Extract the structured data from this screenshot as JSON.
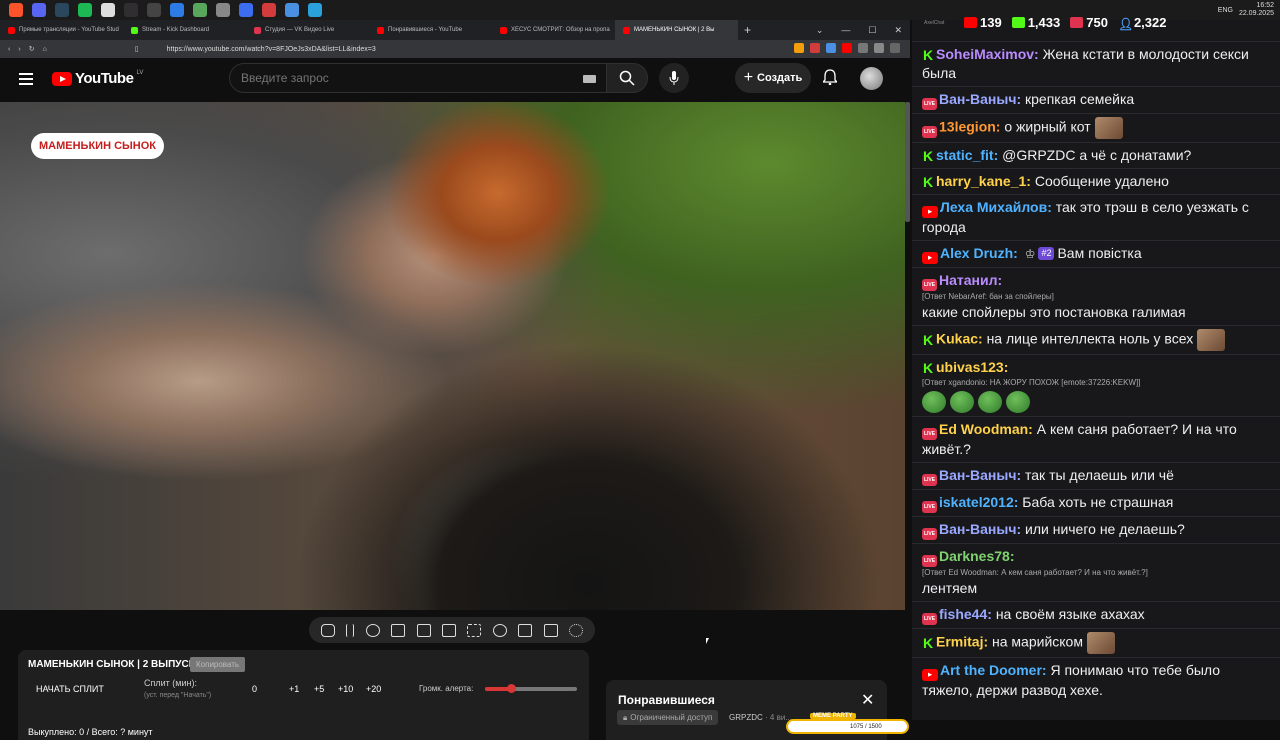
{
  "taskbar": {
    "icons": [
      {
        "name": "brave-icon",
        "color": "#fb542b"
      },
      {
        "name": "discord-icon",
        "color": "#5865f2"
      },
      {
        "name": "steam-icon",
        "color": "#2a475e"
      },
      {
        "name": "spotify-icon",
        "color": "#1db954"
      },
      {
        "name": "chrome-icon",
        "color": "#dddddd"
      },
      {
        "name": "obs-icon",
        "color": "#302e31"
      },
      {
        "name": "app-x-icon",
        "color": "#444444"
      },
      {
        "name": "app-blue-icon",
        "color": "#2d7be5"
      },
      {
        "name": "app-green-icon",
        "color": "#58a55c"
      },
      {
        "name": "app-arrow-icon",
        "color": "#888888"
      },
      {
        "name": "app-round-icon",
        "color": "#3c6cf0"
      },
      {
        "name": "app-red-icon",
        "color": "#d23c3c"
      },
      {
        "name": "app-blue2-icon",
        "color": "#4a90e2"
      },
      {
        "name": "telegram-icon",
        "color": "#2aa1da"
      }
    ],
    "lang": "ENG",
    "time": "16:52",
    "date": "22.09.2025"
  },
  "tabs": [
    {
      "label": "Прямые трансляции - YouTube Stud",
      "color": "#ff0000"
    },
    {
      "label": "Stream - Kick Dashboard",
      "color": "#53fc18"
    },
    {
      "label": "Студия — VK Видео Live",
      "color": "#e0334f"
    },
    {
      "label": "Понравившиеся - YouTube",
      "color": "#ff0000"
    },
    {
      "label": "ХЕСУС СМОТРИТ: Обзор на пропа",
      "color": "#ff0000"
    },
    {
      "label": "МАМЕНЬКИН СЫНОК | 2 Вы",
      "color": "#ff0000"
    }
  ],
  "address": {
    "url": "https://www.youtube.com/watch?v=8FJOeJs3xDA&list=LL&index=3"
  },
  "youtube": {
    "logo_text": "YouTube",
    "country": "LV",
    "search_placeholder": "Введите запрос",
    "create_label": "Создать"
  },
  "video": {
    "badge": "МАМЕНЬКИН СЫНОК"
  },
  "split": {
    "title": "МАМЕНЬКИН СЫНОК | 2 ВЫПУСК",
    "copy": "Копировать",
    "start": "НАЧАТЬ СПЛИТ",
    "min_label": "Сплит (мин):",
    "hint": "(уст. перед \"Начать\")",
    "zero": "0",
    "increments": [
      "+1",
      "+5",
      "+10",
      "+20"
    ],
    "alert_label": "Громк. алерта:",
    "alert_volume": 0.28,
    "bought": "Выкуплено: 0 / Всего: ? минут"
  },
  "liked": {
    "title": "Понравившиеся",
    "restricted": "Ограниченный доступ",
    "owner": "GRPZDC",
    "meta": "· 4 ви..."
  },
  "meme_party": {
    "badge": "MEME PARTY",
    "progress": "1075 / 1500"
  },
  "chat": {
    "app_name": "AxelChat",
    "stats": [
      {
        "platform": "youtube",
        "value": "139",
        "color": "#ff0000"
      },
      {
        "platform": "kick",
        "value": "1,433",
        "color": "#53fc18"
      },
      {
        "platform": "vk",
        "value": "750",
        "color": "#e0334f"
      },
      {
        "platform": "total",
        "value": "2,322",
        "color": "#4aa3ff"
      }
    ],
    "messages": [
      {
        "platform": "kick",
        "user": "SoheiMaximov:",
        "color": "#b98cff",
        "text": "Жена кстати в молодости секси была"
      },
      {
        "platform": "vk",
        "user": "Ван-Ваныч:",
        "color": "#9aa8ff",
        "text": "крепкая семейка"
      },
      {
        "platform": "vk",
        "user": "13legion:",
        "color": "#ff9933",
        "text": "о жирный кот",
        "emote": true
      },
      {
        "platform": "kick",
        "user": "static_fit:",
        "color": "#4fb3ff",
        "text": "@GRPZDC а чё с донатами?"
      },
      {
        "platform": "kick",
        "user": "harry_kane_1:",
        "color": "#ffd24a",
        "text": "Сообщение удалено"
      },
      {
        "platform": "yt",
        "user": "Леха Михайлов:",
        "color": "#4fb3ff",
        "text": "так это трэш в село уезжать с города"
      },
      {
        "platform": "yt",
        "user": "Alex Druzh:",
        "color": "#4fb3ff",
        "crown": true,
        "sub": "#2",
        "text": "Вам повістка"
      },
      {
        "platform": "vk",
        "user": "Натанил:",
        "color": "#b98cff",
        "reply": "[Ответ NebarAref: бан за спойлеры]",
        "text": "какие спойлеры это постановка галимая"
      },
      {
        "platform": "kick",
        "user": "Kukac:",
        "color": "#ffd24a",
        "text": "на лице интеллекта ноль у всех",
        "emote": true
      },
      {
        "platform": "kick",
        "user": "ubivas123:",
        "color": "#ffd24a",
        "reply": "[Ответ xgandonio: НА ЖОРУ ПОХОЖ [emote:37226:KEKW]]",
        "frogs": 4,
        "text": ""
      },
      {
        "platform": "vk",
        "user": "Ed Woodman:",
        "color": "#ffd24a",
        "text": "А кем саня работает? И на что живёт.?"
      },
      {
        "platform": "vk",
        "user": "Ван-Ваныч:",
        "color": "#9aa8ff",
        "text": "так ты делаешь или чё"
      },
      {
        "platform": "vk",
        "user": "iskatel2012:",
        "color": "#4fb3ff",
        "text": "Баба хоть не страшная"
      },
      {
        "platform": "vk",
        "user": "Ван-Ваныч:",
        "color": "#9aa8ff",
        "text": "или ничего не делаешь?"
      },
      {
        "platform": "vk",
        "user": "Darknes78:",
        "color": "#7fd36e",
        "reply": "[Ответ Ed Woodman: А кем саня работает? И на что живёт.?]",
        "text": "лентяем"
      },
      {
        "platform": "vk",
        "user": "fishe44:",
        "color": "#9aa8ff",
        "text": "на своём языке ахахах"
      },
      {
        "platform": "kick",
        "user": "Ermitaj:",
        "color": "#ffd24a",
        "text": "на марийском",
        "emote": true
      },
      {
        "platform": "yt",
        "user": "Art the Doomer:",
        "color": "#4fb3ff",
        "text": "Я понимаю что тебе было тяжело, держи развод хехе."
      }
    ]
  }
}
